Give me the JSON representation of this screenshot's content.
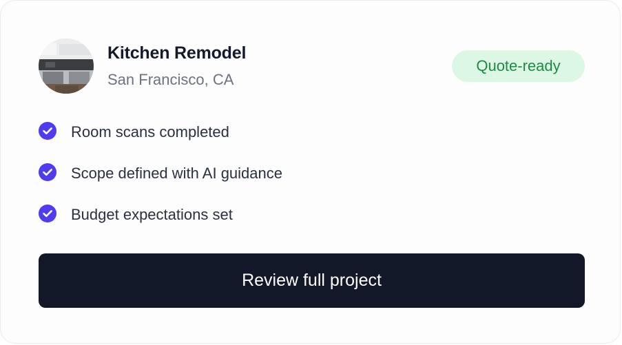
{
  "project": {
    "title": "Kitchen Remodel",
    "location": "San Francisco, CA",
    "status_badge": "Quote-ready"
  },
  "checklist": [
    {
      "label": "Room scans completed",
      "icon": "check-circle-icon"
    },
    {
      "label": "Scope defined with AI guidance",
      "icon": "check-circle-icon"
    },
    {
      "label": "Budget expectations set",
      "icon": "check-circle-icon"
    }
  ],
  "cta": {
    "label": "Review full project"
  },
  "colors": {
    "accent_check": "#4f3bf0",
    "badge_bg": "#dcf7e3",
    "badge_text": "#1f8a43",
    "button_bg": "#121828",
    "title_text": "#141a2b",
    "muted_text": "#6c7281"
  }
}
